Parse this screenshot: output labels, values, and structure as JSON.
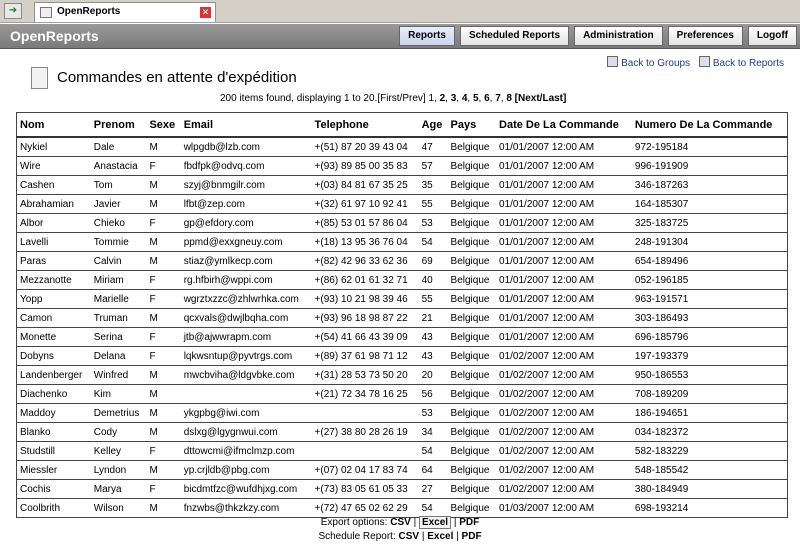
{
  "browser": {
    "tab_title": "OpenReports"
  },
  "app": {
    "brand": "OpenReports"
  },
  "nav": {
    "reports": "Reports",
    "scheduled": "Scheduled Reports",
    "admin": "Administration",
    "prefs": "Preferences",
    "logoff": "Logoff"
  },
  "links": {
    "back_groups": "Back to Groups",
    "back_reports": "Back to Reports"
  },
  "report": {
    "title": "Commandes en attente d'expédition"
  },
  "pager": {
    "summary": "200 items found, displaying 1 to 20.",
    "first_prev": "[First/Prev]",
    "current": "1,",
    "p2": "2",
    "p3": "3",
    "p4": "4",
    "p5": "5",
    "p6": "6",
    "p7": "7",
    "p8": "8",
    "next_last": "[Next/Last]"
  },
  "columns": [
    "Nom",
    "Prenom",
    "Sexe",
    "Email",
    "Telephone",
    "Age",
    "Pays",
    "Date De La Commande",
    "Numero De La Commande"
  ],
  "rows": [
    [
      "Nykiel",
      "Dale",
      "M",
      "wlpgdb@lzb.com",
      "+(51) 87 20 39 43 04",
      "47",
      "Belgique",
      "01/01/2007 12:00 AM",
      "972-195184"
    ],
    [
      "Wire",
      "Anastacia",
      "F",
      "fbdfpk@odvq.com",
      "+(93) 89 85 00 35 83",
      "57",
      "Belgique",
      "01/01/2007 12:00 AM",
      "996-191909"
    ],
    [
      "Cashen",
      "Tom",
      "M",
      "szyj@bnmgilr.com",
      "+(03) 84 81 67 35 25",
      "35",
      "Belgique",
      "01/01/2007 12:00 AM",
      "346-187263"
    ],
    [
      "Abrahamian",
      "Javier",
      "M",
      "lfbt@zep.com",
      "+(32) 61 97 10 92 41",
      "55",
      "Belgique",
      "01/01/2007 12:00 AM",
      "164-185307"
    ],
    [
      "Albor",
      "Chieko",
      "F",
      "gp@efdory.com",
      "+(85) 53 01 57 86 04",
      "53",
      "Belgique",
      "01/01/2007 12:00 AM",
      "325-183725"
    ],
    [
      "Lavelli",
      "Tommie",
      "M",
      "ppmd@exxgneuy.com",
      "+(18) 13 95 36 76 04",
      "54",
      "Belgique",
      "01/01/2007 12:00 AM",
      "248-191304"
    ],
    [
      "Paras",
      "Calvin",
      "M",
      "stiaz@ymlkecp.com",
      "+(82) 42 96 33 62 36",
      "69",
      "Belgique",
      "01/01/2007 12:00 AM",
      "654-189496"
    ],
    [
      "Mezzanotte",
      "Miriam",
      "F",
      "rg.hfbirh@wppi.com",
      "+(86) 62 01 61 32 71",
      "40",
      "Belgique",
      "01/01/2007 12:00 AM",
      "052-196185"
    ],
    [
      "Yopp",
      "Marielle",
      "F",
      "wgrztxzzc@zhlwrhka.com",
      "+(93) 10 21 98 39 46",
      "55",
      "Belgique",
      "01/01/2007 12:00 AM",
      "963-191571"
    ],
    [
      "Camon",
      "Truman",
      "M",
      "qcxvals@dwjlbqha.com",
      "+(93) 96 18 98 87 22",
      "21",
      "Belgique",
      "01/01/2007 12:00 AM",
      "303-186493"
    ],
    [
      "Monette",
      "Serina",
      "F",
      "jtb@ajwwrapm.com",
      "+(54) 41 66 43 39 09",
      "43",
      "Belgique",
      "01/01/2007 12:00 AM",
      "696-185796"
    ],
    [
      "Dobyns",
      "Delana",
      "F",
      "lqkwsntup@pyvtrgs.com",
      "+(89) 37 61 98 71 12",
      "43",
      "Belgique",
      "01/02/2007 12:00 AM",
      "197-193379"
    ],
    [
      "Landenberger",
      "Winfred",
      "M",
      "mwcbviha@ldgvbke.com",
      "+(31) 28 53 73 50 20",
      "20",
      "Belgique",
      "01/02/2007 12:00 AM",
      "950-186553"
    ],
    [
      "Diachenko",
      "Kim",
      "M",
      "",
      "+(21) 72 34 78 16 25",
      "56",
      "Belgique",
      "01/02/2007 12:00 AM",
      "708-189209"
    ],
    [
      "Maddoy",
      "Demetrius",
      "M",
      "ykgpbg@iwi.com",
      "",
      "53",
      "Belgique",
      "01/02/2007 12:00 AM",
      "186-194651"
    ],
    [
      "Blanko",
      "Cody",
      "M",
      "dslxg@lgygnwui.com",
      "+(27) 38 80 28 26 19",
      "34",
      "Belgique",
      "01/02/2007 12:00 AM",
      "034-182372"
    ],
    [
      "Studstill",
      "Kelley",
      "F",
      "dttowcmi@ifmclmzp.com",
      "",
      "54",
      "Belgique",
      "01/02/2007 12:00 AM",
      "582-183229"
    ],
    [
      "Miessler",
      "Lyndon",
      "M",
      "yp.crjldb@pbg.com",
      "+(07) 02 04 17 83 74",
      "64",
      "Belgique",
      "01/02/2007 12:00 AM",
      "548-185542"
    ],
    [
      "Cochis",
      "Marya",
      "F",
      "bicdmtfzc@wufdhjxg.com",
      "+(73) 83 05 61 05 33",
      "27",
      "Belgique",
      "01/02/2007 12:00 AM",
      "380-184949"
    ],
    [
      "Coolbrith",
      "Wilson",
      "M",
      "fnzwbs@thkzkzy.com",
      "+(72) 47 65 02 62 29",
      "54",
      "Belgique",
      "01/03/2007 12:00 AM",
      "698-193214"
    ]
  ],
  "export": {
    "label": "Export options:",
    "csv": "CSV",
    "excel": "Excel",
    "pdf": "PDF",
    "sep": "|"
  },
  "schedule": {
    "label": "Schedule Report:",
    "csv": "CSV",
    "excel": "Excel",
    "pdf": "PDF",
    "sep": "|"
  }
}
